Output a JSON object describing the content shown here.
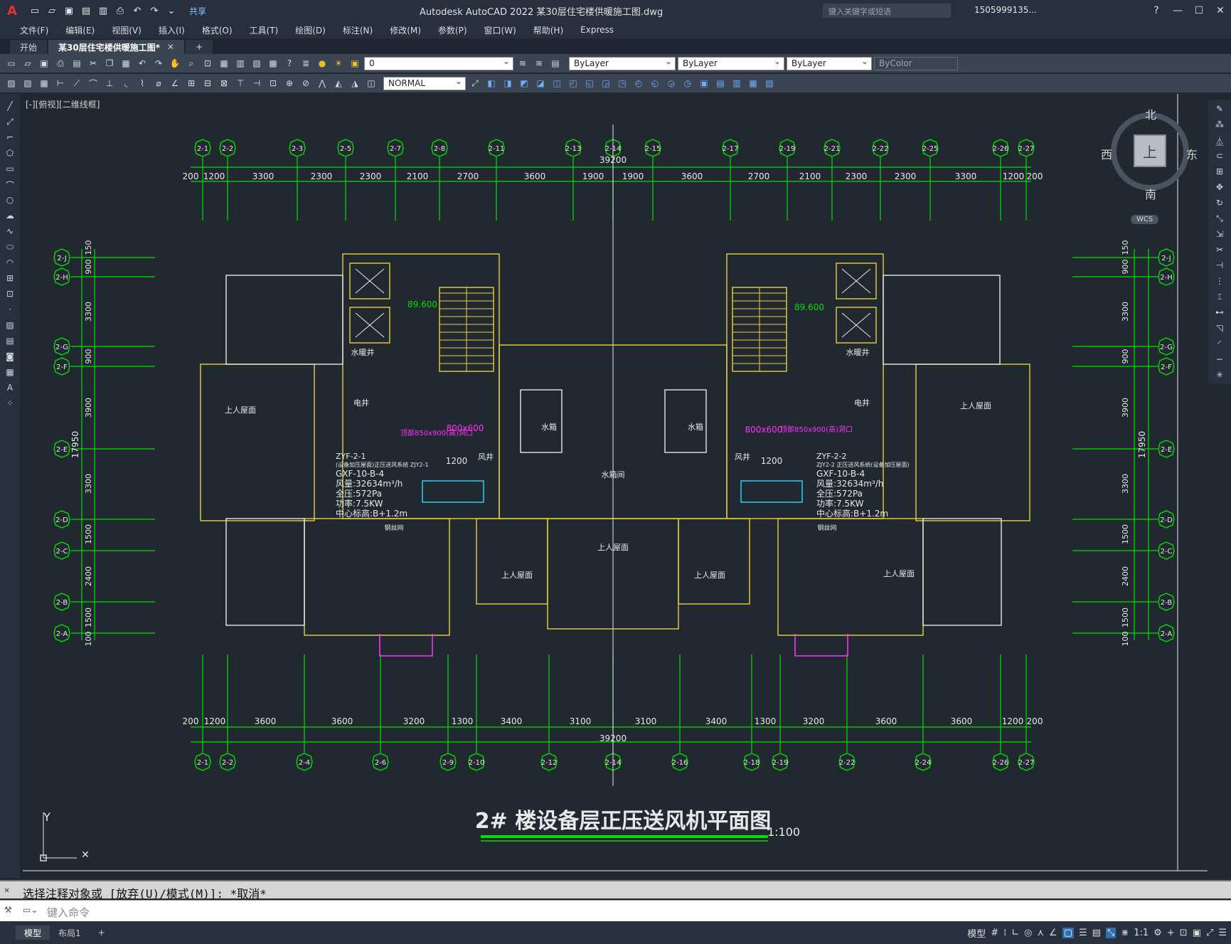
{
  "app": {
    "title": "Autodesk AutoCAD 2022    某30层住宅楼供暖施工图.dwg",
    "logo_letter": "A",
    "share_label": "共享",
    "search_placeholder": "键入关键字或短语",
    "user": "1505999135...",
    "help_label": "?"
  },
  "menu": [
    "文件(F)",
    "编辑(E)",
    "视图(V)",
    "插入(I)",
    "格式(O)",
    "工具(T)",
    "绘图(D)",
    "标注(N)",
    "修改(M)",
    "参数(P)",
    "窗口(W)",
    "帮助(H)",
    "Express"
  ],
  "tabs": [
    {
      "label": "开始",
      "active": false
    },
    {
      "label": "某30层住宅楼供暖施工图*",
      "active": true
    }
  ],
  "toolbar": {
    "layer_value": "0",
    "color_value": "ByLayer",
    "linetype_value": "ByLayer",
    "lineweight_value": "ByLayer",
    "plotstyle_value": "ByColor",
    "style_value": "NORMAL"
  },
  "viewport": {
    "label": "[-][俯视][二维线框]",
    "compass": {
      "north": "北",
      "south": "南",
      "east": "东",
      "west": "西",
      "cube": "上"
    },
    "wcs": "WCS"
  },
  "drawing": {
    "title": "2# 楼设备层正压送风机平面图",
    "scale": "1:100",
    "total_width": "39200",
    "total_height": "17950",
    "top_axes": [
      "2-1",
      "2-2",
      "2-3",
      "2-5",
      "2-7",
      "2-8",
      "2-11",
      "2-13",
      "2-14",
      "2-15",
      "2-17",
      "2-19",
      "2-21",
      "2-22",
      "2-25",
      "2-26",
      "2-27"
    ],
    "top_dims": [
      "200",
      "1200",
      "3300",
      "2300",
      "2300",
      "2100",
      "2700",
      "3600",
      "1900",
      "1900",
      "3600",
      "2700",
      "2100",
      "2300",
      "2300",
      "3300",
      "1200",
      "200"
    ],
    "bottom_axes": [
      "2-1",
      "2-2",
      "2-4",
      "2-6",
      "2-9",
      "2-10",
      "2-12",
      "2-14",
      "2-16",
      "2-18",
      "2-19",
      "2-22",
      "2-24",
      "2-26",
      "2-27"
    ],
    "bottom_dims": [
      "200",
      "1200",
      "3600",
      "3600",
      "3200",
      "1300",
      "3400",
      "3100",
      "3100",
      "3400",
      "1300",
      "3200",
      "3600",
      "3600",
      "1200",
      "200"
    ],
    "side_axes": [
      "2-J",
      "2-H",
      "2-G",
      "2-F",
      "2-E",
      "2-D",
      "2-C",
      "2-B",
      "2-A"
    ],
    "side_dims": [
      "150",
      "900",
      "3300",
      "900",
      "3900",
      "3300",
      "1500",
      "2400",
      "1500",
      "100"
    ],
    "rooms": [
      "上人屋面",
      "上人屋面",
      "上人屋面",
      "上人屋面",
      "上人屋面",
      "上人屋面",
      "水箱间",
      "水箱",
      "水箱",
      "水暖井",
      "水暖井",
      "电井",
      "电井",
      "风井",
      "风井"
    ],
    "equipment_left": {
      "tag": "ZYF-2-1",
      "system": "(设备加压屋面)正压送风系统 ZJY2-1",
      "model": "GXF-10-B-4",
      "airflow": "风量:32634m³/h",
      "pressure": "全压:572Pa",
      "power": "功率:7.5KW",
      "center": "中心标高:B+1.2m",
      "elev": "89.600",
      "dim": "1200",
      "damper": "800x600",
      "opening": "顶部850x900(高)洞口",
      "note": "钢丝网"
    },
    "equipment_right": {
      "tag": "ZYF-2-2",
      "system": "ZJY2-2 正压送风系统(设备加压屋面)",
      "model": "GXF-10-B-4",
      "airflow": "风量:32634m³/h",
      "pressure": "全压:572Pa",
      "power": "功率:7.5KW",
      "center": "中心标高:B+1.2m",
      "elev": "89.600",
      "dim": "1200",
      "damper": "800x600",
      "opening": "顶部850x900(高)洞口",
      "note": "钢丝网"
    }
  },
  "command": {
    "history": "选择注释对象或 [放弃(U)/模式(M)]: *取消*",
    "placeholder": "键入命令"
  },
  "status": {
    "tabs": [
      {
        "label": "模型",
        "active": true
      },
      {
        "label": "布局1",
        "active": false
      }
    ],
    "model_label": "模型",
    "scale": "1:1"
  },
  "colors": {
    "background": "#212830",
    "axis": "#00e000",
    "wall": "#e8d040",
    "magenta": "#ff30ff",
    "cyan": "#20e0ff",
    "white": "#e8e8e8"
  }
}
